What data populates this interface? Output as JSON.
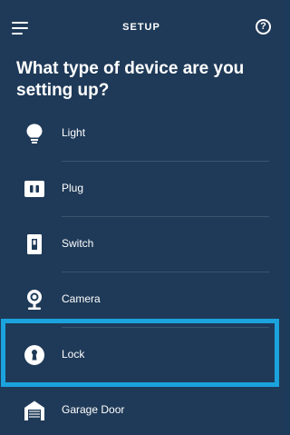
{
  "header": {
    "title": "SETUP",
    "help_label": "?"
  },
  "page_title": "What type of device are you setting up?",
  "devices": [
    {
      "label": "Light",
      "icon": "lightbulb-icon"
    },
    {
      "label": "Plug",
      "icon": "plug-icon"
    },
    {
      "label": "Switch",
      "icon": "switch-icon"
    },
    {
      "label": "Camera",
      "icon": "camera-icon"
    },
    {
      "label": "Lock",
      "icon": "lock-icon",
      "selected": true
    },
    {
      "label": "Garage Door",
      "icon": "garage-door-icon"
    }
  ],
  "colors": {
    "background": "#1f3a58",
    "highlight": "#1ba3dd",
    "text": "#ffffff"
  }
}
